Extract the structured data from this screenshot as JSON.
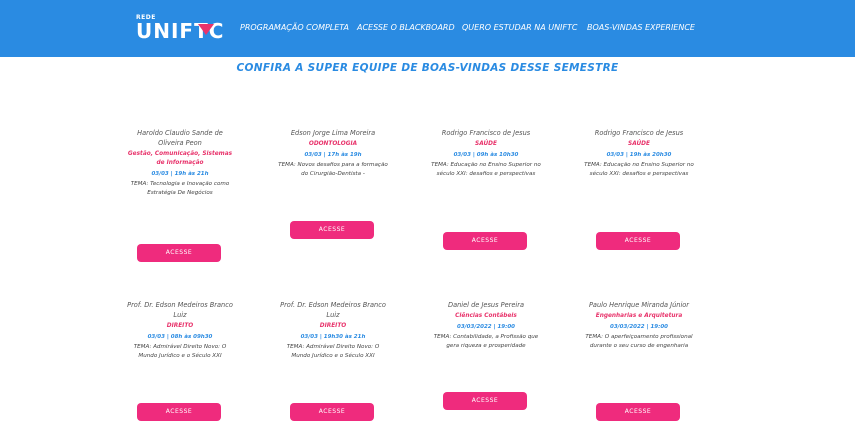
{
  "header": {
    "logo_small": "REDE",
    "logo_big": "UNIFTC",
    "nav": [
      "PROGRAMAÇÃO COMPLETA",
      "ACESSE O BLACKBOARD",
      "QUERO ESTUDAR NA UNIFTC",
      "BOAS-VINDAS EXPERIENCE"
    ],
    "brand_color": "#2a8be2",
    "accent_color": "#e8336b"
  },
  "headline": "CONFIRA A SUPER EQUIPE DE BOAS-VINDAS DESSE SEMESTRE",
  "cards": [
    {
      "name": "Haroldo Claudio Sande de Oliveira Peon",
      "area": "Gestão, Comunicação, Sistemas de Informação",
      "time": "03/03 | 19h às 21h",
      "topic": "TEMA: Tecnologia e Inovação como Estratégia De Negócios",
      "button": "ACESSE"
    },
    {
      "name": "Edson Jorge Lima Moreira",
      "area": "ODONTOLOGIA",
      "time": "03/03 | 17h às 19h",
      "topic": "TEMA: Novos desafios para a formação do Cirurgião-Dentista -",
      "button": "ACESSE"
    },
    {
      "name": "Rodrigo Francisco de Jesus",
      "area": "SAÚDE",
      "time": "03/03 | 09h às 10h30",
      "topic": "TEMA: Educação no Ensino Superior no século XXI: desafios e perspectivas",
      "button": "ACESSE"
    },
    {
      "name": "Rodrigo Francisco de Jesus",
      "area": "SAÚDE",
      "time": "03/03 | 19h às 20h30",
      "topic": "TEMA: Educação no Ensino Superior no século XXI: desafios e perspectivas",
      "button": "ACESSE"
    },
    {
      "name": "Prof. Dr. Edson Medeiros Branco Luiz",
      "area": "DIREITO",
      "time": "03/03 | 08h às 09h30",
      "topic": "TEMA: Admirável Direito Novo: O Mundo Jurídico e o Século XXI",
      "button": "ACESSE"
    },
    {
      "name": "Prof. Dr. Edson Medeiros Branco Luiz",
      "area": "DIREITO",
      "time": "03/03 | 19h30 às 21h",
      "topic": "TEMA: Admirável Direito Novo: O Mundo Jurídico e o Século XXI",
      "button": "ACESSE"
    },
    {
      "name": "Daniel de Jesus Pereira",
      "area": "Ciências Contábeis",
      "time": "03/03/2022 | 19:00",
      "topic": "TEMA: Contabilidade, a Profissão que gera riqueza e prosperidade",
      "button": "ACESSE"
    },
    {
      "name": "Paulo Henrique Miranda Júnior",
      "area": "Engenharias e Arquitetura",
      "time": "03/03/2022 | 19:00",
      "topic": "TEMA: O aperfeiçoamento profissional durante o seu curso de engenharia",
      "button": "ACESSE"
    }
  ]
}
